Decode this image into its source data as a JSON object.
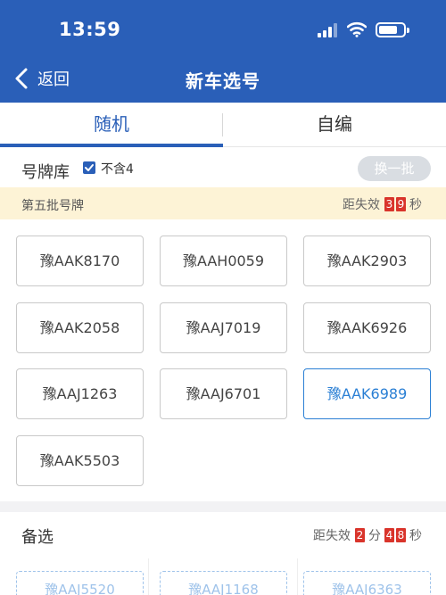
{
  "status_bar": {
    "time": "13:59"
  },
  "nav": {
    "back_label": "返回",
    "title": "新车选号"
  },
  "tabs": [
    {
      "label": "随机",
      "active": true
    },
    {
      "label": "自编",
      "active": false
    }
  ],
  "pool": {
    "title": "号牌库",
    "exclude_four": {
      "label": "不含4",
      "checked": true
    },
    "swap_button": "换一批"
  },
  "batch": {
    "label": "第五批号牌",
    "expire_prefix": "距失效",
    "seconds_digits": [
      "3",
      "9"
    ],
    "seconds_unit": "秒"
  },
  "plates": [
    {
      "text": "豫AAK8170",
      "selected": false
    },
    {
      "text": "豫AAH0059",
      "selected": false
    },
    {
      "text": "豫AAK2903",
      "selected": false
    },
    {
      "text": "豫AAK2058",
      "selected": false
    },
    {
      "text": "豫AAJ7019",
      "selected": false
    },
    {
      "text": "豫AAK6926",
      "selected": false
    },
    {
      "text": "豫AAJ1263",
      "selected": false
    },
    {
      "text": "豫AAJ6701",
      "selected": false
    },
    {
      "text": "豫AAK6989",
      "selected": true
    },
    {
      "text": "豫AAK5503",
      "selected": false
    }
  ],
  "alternates": {
    "title": "备选",
    "expire_prefix": "距失效",
    "minutes_digits": [
      "2"
    ],
    "minutes_unit": "分",
    "seconds_digits": [
      "4",
      "8"
    ],
    "seconds_unit": "秒",
    "items": [
      "豫AAJ5520",
      "豫AAJ1168",
      "豫AAJ6363"
    ]
  },
  "colors": {
    "brand": "#2a5fb8",
    "selected": "#2a7fd4",
    "countdown": "#d9342b",
    "notice_bg": "#fdf3d6"
  }
}
